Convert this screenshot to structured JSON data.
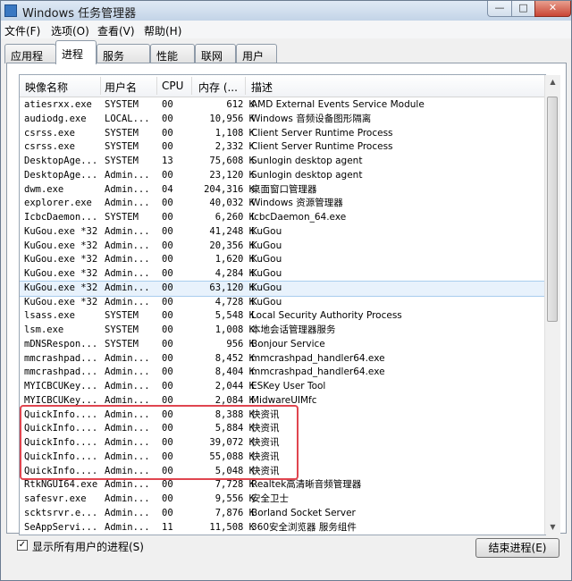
{
  "window": {
    "title": "Windows 任务管理器",
    "min": "—",
    "max": "□",
    "close": "✕"
  },
  "menu": [
    "文件(F)",
    "选项(O)",
    "查看(V)",
    "帮助(H)"
  ],
  "tabs": [
    "应用程序",
    "进程",
    "服务",
    "性能",
    "联网",
    "用户"
  ],
  "active_tab": 1,
  "columns": {
    "name": "映像名称",
    "user": "用户名",
    "cpu": "CPU",
    "mem": "内存 (...",
    "desc": "描述"
  },
  "rows": [
    [
      "atiesrxx.exe",
      "SYSTEM",
      "00",
      "612 K",
      "AMD External Events Service Module"
    ],
    [
      "audiodg.exe",
      "LOCAL...",
      "00",
      "10,956 K",
      "Windows 音频设备图形隔离"
    ],
    [
      "csrss.exe",
      "SYSTEM",
      "00",
      "1,108 K",
      "Client Server Runtime Process"
    ],
    [
      "csrss.exe",
      "SYSTEM",
      "00",
      "2,332 K",
      "Client Server Runtime Process"
    ],
    [
      "DesktopAge...",
      "SYSTEM",
      "13",
      "75,608 K",
      "Sunlogin desktop agent"
    ],
    [
      "DesktopAge...",
      "Admin...",
      "00",
      "23,120 K",
      "Sunlogin desktop agent"
    ],
    [
      "dwm.exe",
      "Admin...",
      "04",
      "204,316 K",
      "桌面窗口管理器"
    ],
    [
      "explorer.exe",
      "Admin...",
      "00",
      "40,032 K",
      "Windows 资源管理器"
    ],
    [
      "IcbcDaemon...",
      "SYSTEM",
      "00",
      "6,260 K",
      "IcbcDaemon_64.exe"
    ],
    [
      "KuGou.exe *32",
      "Admin...",
      "00",
      "41,248 K",
      "KuGou"
    ],
    [
      "KuGou.exe *32",
      "Admin...",
      "00",
      "20,356 K",
      "KuGou"
    ],
    [
      "KuGou.exe *32",
      "Admin...",
      "00",
      "1,620 K",
      "KuGou"
    ],
    [
      "KuGou.exe *32",
      "Admin...",
      "00",
      "4,284 K",
      "KuGou"
    ],
    [
      "KuGou.exe *32",
      "Admin...",
      "00",
      "63,120 K",
      "KuGou"
    ],
    [
      "KuGou.exe *32",
      "Admin...",
      "00",
      "4,728 K",
      "KuGou"
    ],
    [
      "lsass.exe",
      "SYSTEM",
      "00",
      "5,548 K",
      "Local Security Authority Process"
    ],
    [
      "lsm.exe",
      "SYSTEM",
      "00",
      "1,008 K",
      "本地会话管理器服务"
    ],
    [
      "mDNSRespon...",
      "SYSTEM",
      "00",
      "956 K",
      "Bonjour Service"
    ],
    [
      "mmcrashpad...",
      "Admin...",
      "00",
      "8,452 K",
      "mmcrashpad_handler64.exe"
    ],
    [
      "mmcrashpad...",
      "Admin...",
      "00",
      "8,404 K",
      "mmcrashpad_handler64.exe"
    ],
    [
      "MYICBCUKey...",
      "Admin...",
      "00",
      "2,044 K",
      "ESKey User Tool"
    ],
    [
      "MYICBCUKey...",
      "Admin...",
      "00",
      "2,084 K",
      "MidwareUIMfc"
    ],
    [
      "QuickInfo....",
      "Admin...",
      "00",
      "8,388 K",
      "快资讯"
    ],
    [
      "QuickInfo....",
      "Admin...",
      "00",
      "5,884 K",
      "快资讯"
    ],
    [
      "QuickInfo....",
      "Admin...",
      "00",
      "39,072 K",
      "快资讯"
    ],
    [
      "QuickInfo....",
      "Admin...",
      "00",
      "55,088 K",
      "快资讯"
    ],
    [
      "QuickInfo....",
      "Admin...",
      "00",
      "5,048 K",
      "快资讯"
    ],
    [
      "RtkNGUI64.exe",
      "Admin...",
      "00",
      "7,728 K",
      "Realtek高清晰音频管理器"
    ],
    [
      "safesvr.exe",
      "Admin...",
      "00",
      "9,556 K",
      "安全卫士"
    ],
    [
      "scktsrvr.e...",
      "Admin...",
      "00",
      "7,876 K",
      "Borland Socket Server"
    ],
    [
      "SeAppServi...",
      "Admin...",
      "11",
      "11,508 K",
      "360安全浏览器 服务组件"
    ]
  ],
  "selected_row": 13,
  "show_all_label": "显示所有用户的进程(S)",
  "show_all_checked": "✓",
  "end_process_label": "结束进程(E)",
  "colors": {
    "highlight_box": "#e0454f",
    "selection": "#e8f2fc"
  }
}
